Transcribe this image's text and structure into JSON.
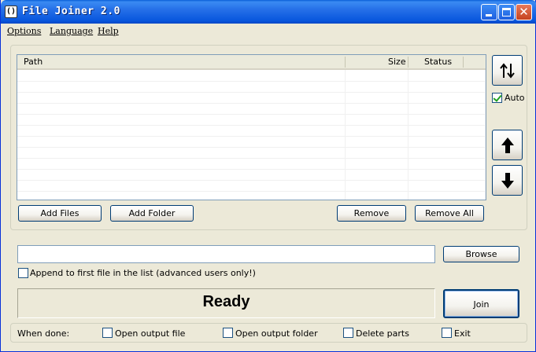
{
  "window": {
    "title": "File Joiner 2.0",
    "app_icon_glyph": "()"
  },
  "menu": {
    "options": "Options",
    "language": "Language",
    "help": "Help"
  },
  "list": {
    "columns": {
      "path": "Path",
      "size": "Size",
      "status": "Status"
    },
    "rows": []
  },
  "buttons": {
    "add_files": "Add Files",
    "add_folder": "Add Folder",
    "remove": "Remove",
    "remove_all": "Remove All",
    "browse": "Browse",
    "join": "Join"
  },
  "side_controls": {
    "sort_icon": "sort-toggle-icon",
    "auto_label": "Auto",
    "auto_checked": true,
    "move_up_icon": "arrow-up-icon",
    "move_down_icon": "arrow-down-icon"
  },
  "output": {
    "path_value": "",
    "append_label": "Append to first file in the list (advanced users only!)",
    "append_checked": false
  },
  "status": {
    "text": "Ready"
  },
  "when_done": {
    "label": "When done:",
    "open_output_file": "Open output file",
    "open_output_folder": "Open output folder",
    "delete_parts": "Delete parts",
    "exit": "Exit"
  },
  "colors": {
    "titlebar": "#2670e8",
    "window_bg": "#ece9d8",
    "button_border": "#003c74",
    "check_mark": "#21a121"
  }
}
